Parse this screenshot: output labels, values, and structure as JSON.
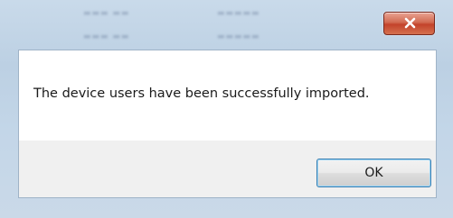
{
  "dialog": {
    "message": "The device users have been successfully imported.",
    "ok_label": "OK",
    "close_icon": "close-icon"
  },
  "colors": {
    "close_button": "#c3432b",
    "ok_focus_border": "#3c7fb1",
    "content_bg": "#ffffff",
    "footer_bg": "#f0f0f0"
  }
}
